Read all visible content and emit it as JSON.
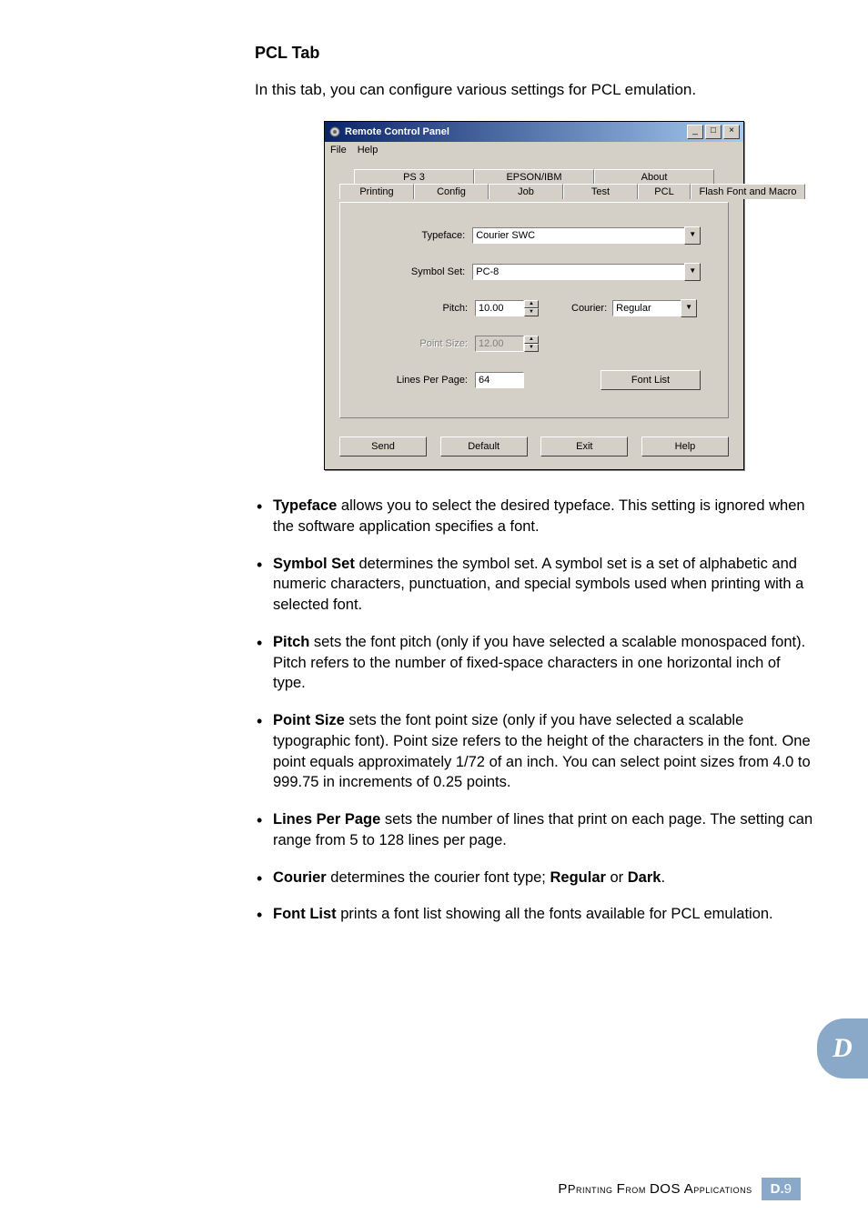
{
  "heading": "PCL Tab",
  "intro": "In this tab, you can configure various settings for PCL emulation.",
  "window": {
    "title": "Remote Control Panel",
    "menu": {
      "file": "File",
      "help": "Help"
    },
    "sysbuttons": {
      "min": "_",
      "max": "□",
      "close": "×"
    },
    "tabs_back": [
      "PS 3",
      "EPSON/IBM",
      "About"
    ],
    "tabs_front": [
      "Printing",
      "Config",
      "Job",
      "Test",
      "PCL",
      "Flash Font and Macro"
    ],
    "active_tab": "PCL",
    "fields": {
      "typeface_label": "Typeface:",
      "typeface_value": "Courier SWC",
      "symbolset_label": "Symbol Set:",
      "symbolset_value": "PC-8",
      "pitch_label": "Pitch:",
      "pitch_value": "10.00",
      "courier_label": "Courier:",
      "courier_value": "Regular",
      "pointsize_label": "Point Size:",
      "pointsize_value": "12.00",
      "lpp_label": "Lines Per Page:",
      "lpp_value": "64",
      "fontlist_btn": "Font List"
    },
    "buttons": {
      "send": "Send",
      "default": "Default",
      "exit": "Exit",
      "help": "Help"
    }
  },
  "bullets": {
    "typeface": {
      "term": "Typeface",
      "rest": " allows you to select the desired typeface. This setting is ignored when the software application specifies a font."
    },
    "symbolset": {
      "term": "Symbol Set",
      "rest": " determines the symbol set. A symbol set is a set of alphabetic and numeric characters, punctuation, and special symbols used when printing with a selected font."
    },
    "pitch": {
      "term": "Pitch",
      "rest": " sets the font pitch (only if you have selected a scalable monospaced font). Pitch refers to the number of fixed-space characters in one horizontal inch of type."
    },
    "pointsize": {
      "term": "Point Size",
      "rest": " sets the font point size (only if you have selected a scalable typographic font). Point size refers to the height of the characters in the font. One point equals approximately 1/72 of an inch. You can select point sizes from 4.0 to 999.75 in increments of 0.25 points."
    },
    "lpp": {
      "term": "Lines Per Page",
      "rest": " sets the number of lines that print on each page. The setting can range from 5 to 128 lines per page."
    },
    "courier": {
      "term": "Courier",
      "pre": " determines the courier font type; ",
      "opt1": "Regular",
      "mid": " or ",
      "opt2": "Dark",
      "post": "."
    },
    "fontlist": {
      "term": "Font List",
      "rest": " prints a font list showing all the fonts available for PCL emulation."
    }
  },
  "sidetab": "D",
  "footer": {
    "text_a": "Printing ",
    "text_b": "From",
    "text_c": " DOS A",
    "text_d": "pplications",
    "page_prefix": "D.",
    "page_num": "9"
  }
}
